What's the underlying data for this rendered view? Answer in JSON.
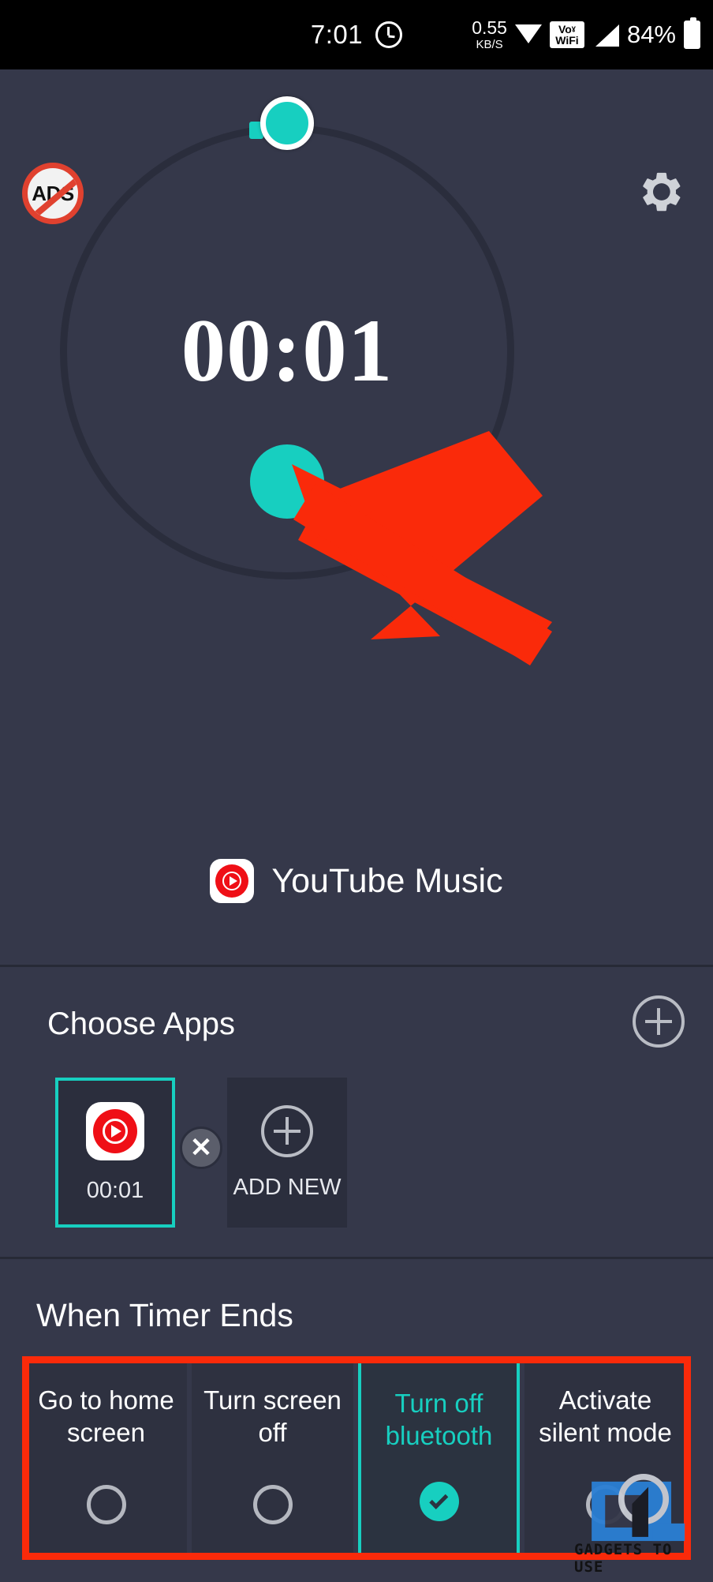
{
  "status_bar": {
    "time": "7:01",
    "clock_icon": "clock-icon",
    "net_speed_value": "0.55",
    "net_speed_unit": "KB/S",
    "wifi_icon": "wifi-icon",
    "volte_line1": "Voˠ",
    "volte_line2": "WiFi",
    "signal_icon": "signal-bars-icon",
    "battery_percent": "84%",
    "battery_icon": "battery-icon"
  },
  "app_bar": {
    "no_ads_label": "ADS",
    "no_ads_icon": "no-ads-badge-icon",
    "settings_icon": "gear-icon"
  },
  "timer": {
    "value": "00:01",
    "handle_icon": "dial-handle",
    "play_button_icon": "play-button",
    "selected_app_name": "YouTube Music",
    "selected_app_icon": "youtube-music-icon"
  },
  "choose_apps": {
    "title": "Choose Apps",
    "add_icon": "plus-circle-icon",
    "remove_icon": "close-x-icon",
    "cards": [
      {
        "icon": "youtube-music-icon",
        "label": "00:01",
        "selected": true
      },
      {
        "icon": "plus-circle-icon",
        "label": "ADD NEW",
        "selected": false
      }
    ]
  },
  "when_timer_ends": {
    "title": "When Timer Ends",
    "options": [
      {
        "label": "Go to home screen",
        "selected": false
      },
      {
        "label": "Turn screen off",
        "selected": false
      },
      {
        "label": "Turn off bluetooth",
        "selected": true
      },
      {
        "label": "Activate silent mode",
        "selected": false
      }
    ]
  },
  "watermark": {
    "text": "GADGETS TO USE"
  },
  "colors": {
    "accent_teal": "#17cfc0",
    "highlight_red": "#fa2a0a",
    "panel_bg": "#35384a",
    "card_bg": "#2e3140",
    "youtube_red": "#ef0f16"
  }
}
